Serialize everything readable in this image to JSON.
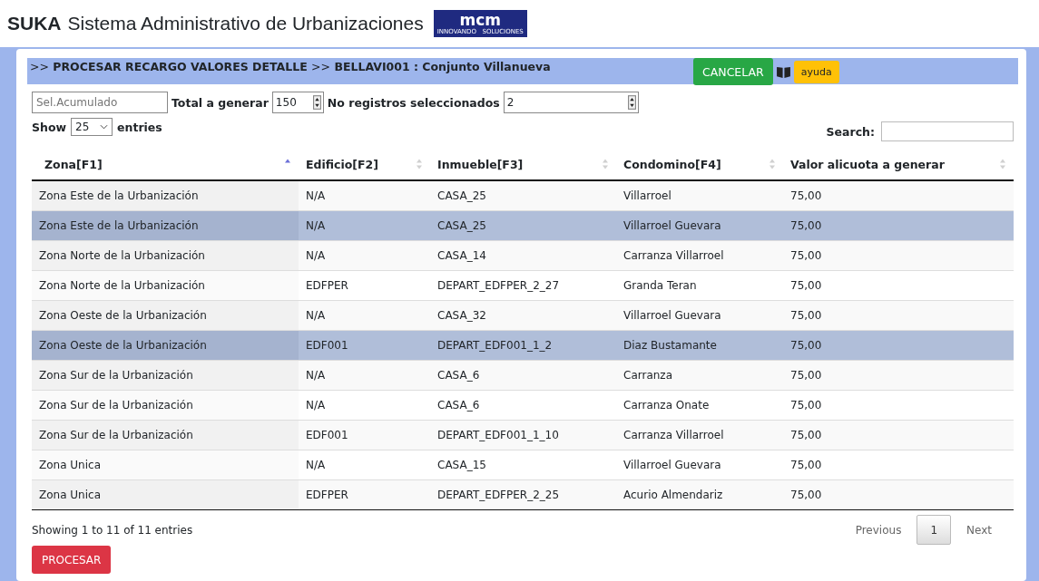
{
  "app": {
    "brand": "SUKA",
    "title": "Sistema Administrativo de Urbanizaciones",
    "logo_text": "mcm",
    "logo_subtext": "INNOVANDO   SOLUCIONES"
  },
  "breadcrumb": {
    "prefix_1": ">>",
    "section": "PROCESAR RECARGO VALORES DETALLE",
    "prefix_2": ">>",
    "context": "BELLAVI001 : Conjunto Villanueva"
  },
  "actions": {
    "cancel": "CANCELAR",
    "help": "ayuda"
  },
  "filters": {
    "accumulated": {
      "placeholder": "Sel.Acumulado"
    },
    "total_label": "Total a generar",
    "total_value": "150",
    "selected_label": "No registros seleccionados",
    "selected_value": "2"
  },
  "length": {
    "show": "Show",
    "value": "25",
    "entries": "entries"
  },
  "search": {
    "label": "Search:"
  },
  "table": {
    "columns": [
      {
        "label": "Zona[F1]",
        "sorted": true
      },
      {
        "label": "Edificio[F2]",
        "sorted": false
      },
      {
        "label": "Inmueble[F3]",
        "sorted": false
      },
      {
        "label": "Condomino[F4]",
        "sorted": false
      },
      {
        "label": "Valor alicuota a generar",
        "sorted": false
      }
    ],
    "rows": [
      {
        "cells": [
          "Zona Este de la Urbanización",
          "N/A",
          "CASA_25",
          "Villarroel",
          "75,00"
        ],
        "selected": false
      },
      {
        "cells": [
          "Zona Este de la Urbanización",
          "N/A",
          "CASA_25",
          "Villarroel Guevara",
          "75,00"
        ],
        "selected": true
      },
      {
        "cells": [
          "Zona Norte de la Urbanización",
          "N/A",
          "CASA_14",
          "Carranza Villarroel",
          "75,00"
        ],
        "selected": false
      },
      {
        "cells": [
          "Zona Norte de la Urbanización",
          "EDFPER",
          "DEPART_EDFPER_2_27",
          "Granda Teran",
          "75,00"
        ],
        "selected": false
      },
      {
        "cells": [
          "Zona Oeste de la Urbanización",
          "N/A",
          "CASA_32",
          "Villarroel Guevara",
          "75,00"
        ],
        "selected": false
      },
      {
        "cells": [
          "Zona Oeste de la Urbanización",
          "EDF001",
          "DEPART_EDF001_1_2",
          "Diaz Bustamante",
          "75,00"
        ],
        "selected": true
      },
      {
        "cells": [
          "Zona Sur de la Urbanización",
          "N/A",
          "CASA_6",
          "Carranza",
          "75,00"
        ],
        "selected": false
      },
      {
        "cells": [
          "Zona Sur de la Urbanización",
          "N/A",
          "CASA_6",
          "Carranza Onate",
          "75,00"
        ],
        "selected": false
      },
      {
        "cells": [
          "Zona Sur de la Urbanización",
          "EDF001",
          "DEPART_EDF001_1_10",
          "Carranza Villarroel",
          "75,00"
        ],
        "selected": false
      },
      {
        "cells": [
          "Zona Unica",
          "N/A",
          "CASA_15",
          "Villarroel Guevara",
          "75,00"
        ],
        "selected": false
      },
      {
        "cells": [
          "Zona Unica",
          "EDFPER",
          "DEPART_EDFPER_2_25",
          "Acurio Almendariz",
          "75,00"
        ],
        "selected": false
      }
    ]
  },
  "info": "Showing 1 to 11 of 11 entries",
  "pagination": {
    "previous": "Previous",
    "pages": [
      {
        "label": "1",
        "selected": true
      }
    ],
    "next": "Next"
  },
  "process_button": "PROCESAR"
}
